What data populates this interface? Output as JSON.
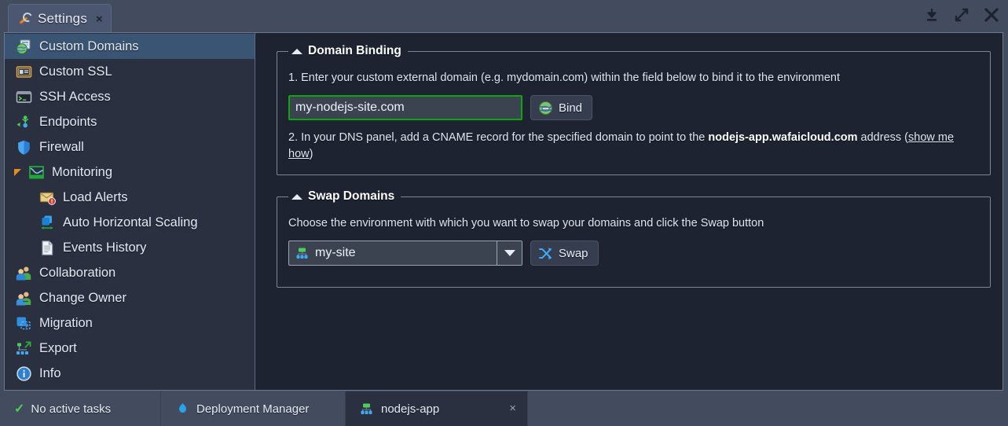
{
  "window": {
    "tab_title": "Settings",
    "tab_icon": "wrench-icon",
    "close_label": "×",
    "controls": [
      {
        "name": "download-icon"
      },
      {
        "name": "expand-icon"
      },
      {
        "name": "close-icon"
      }
    ]
  },
  "sidebar": {
    "items": [
      {
        "label": "Custom Domains",
        "icon": "globe-page-icon",
        "selected": true,
        "sub": false,
        "expander": false
      },
      {
        "label": "Custom SSL",
        "icon": "certificate-icon",
        "selected": false,
        "sub": false,
        "expander": false
      },
      {
        "label": "SSH Access",
        "icon": "terminal-icon",
        "selected": false,
        "sub": false,
        "expander": false
      },
      {
        "label": "Endpoints",
        "icon": "endpoints-icon",
        "selected": false,
        "sub": false,
        "expander": false
      },
      {
        "label": "Firewall",
        "icon": "shield-icon",
        "selected": false,
        "sub": false,
        "expander": false
      },
      {
        "label": "Monitoring",
        "icon": "chart-icon",
        "selected": false,
        "sub": false,
        "expander": true
      },
      {
        "label": "Load Alerts",
        "icon": "mail-alert-icon",
        "selected": false,
        "sub": true,
        "expander": false
      },
      {
        "label": "Auto Horizontal Scaling",
        "icon": "scaling-icon",
        "selected": false,
        "sub": true,
        "expander": false
      },
      {
        "label": "Events History",
        "icon": "document-icon",
        "selected": false,
        "sub": true,
        "expander": false
      },
      {
        "label": "Collaboration",
        "icon": "users-icon",
        "selected": false,
        "sub": false,
        "expander": false
      },
      {
        "label": "Change Owner",
        "icon": "change-owner-icon",
        "selected": false,
        "sub": false,
        "expander": false
      },
      {
        "label": "Migration",
        "icon": "migration-icon",
        "selected": false,
        "sub": false,
        "expander": false
      },
      {
        "label": "Export",
        "icon": "export-icon",
        "selected": false,
        "sub": false,
        "expander": false
      },
      {
        "label": "Info",
        "icon": "info-icon",
        "selected": false,
        "sub": false,
        "expander": false
      }
    ]
  },
  "domain_binding": {
    "legend": "Domain Binding",
    "step1": "1. Enter your custom external domain (e.g. mydomain.com) within the field below to bind it to the environment",
    "domain_value": "my-nodejs-site.com",
    "domain_placeholder": "mydomain.com",
    "bind_label": "Bind",
    "bind_icon": "globe-link-icon",
    "step2_prefix": "2. In your DNS panel, add a CNAME record for the specified domain to point to the ",
    "step2_bold": "nodejs-app.wafaicloud.com",
    "step2_mid": " address (",
    "step2_link": "show me how",
    "step2_suffix": ")"
  },
  "swap_domains": {
    "legend": "Swap Domains",
    "description": "Choose the environment with which you want to swap your domains and click the Swap button",
    "selected_env": "my-site",
    "env_icon": "environment-icon",
    "swap_label": "Swap",
    "swap_icon": "swap-arrows-icon"
  },
  "taskbar": {
    "tasks_label": "No active tasks",
    "tasks_icon": "check-icon",
    "deployment_label": "Deployment Manager",
    "deployment_icon": "cloud-icon",
    "env_label": "nodejs-app",
    "env_icon": "environment-icon",
    "env_close": "×"
  },
  "colors": {
    "accent_green": "#0fa50f",
    "selection_blue": "#3a5573",
    "panel_bg": "#1d2330",
    "sidebar_bg": "#2b3040",
    "chrome_bg": "#434c5e"
  }
}
